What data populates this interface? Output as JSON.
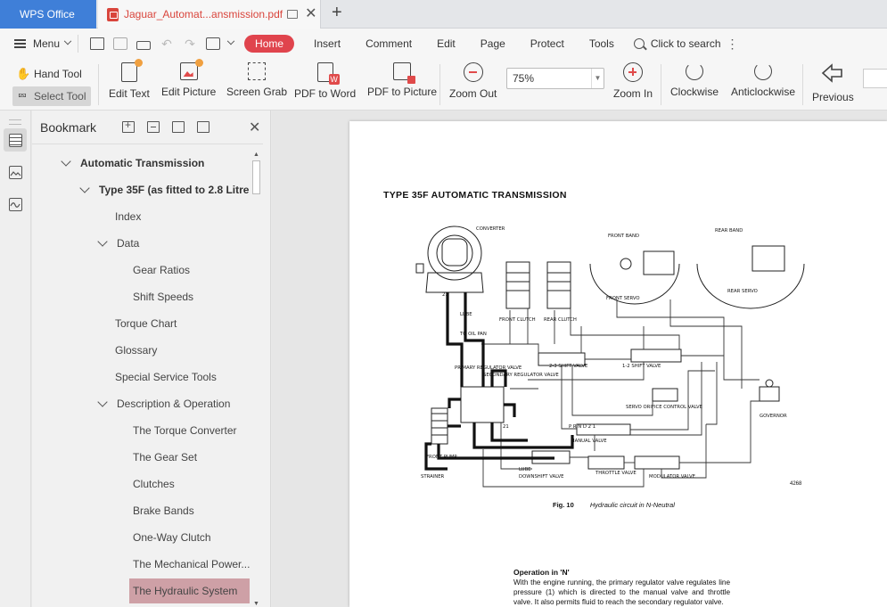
{
  "titlebar": {
    "app_name": "WPS Office",
    "doc_tab_title": "Jaguar_Automat...ansmission.pdf"
  },
  "menubar": {
    "menu_label": "Menu",
    "tabs": [
      "Home",
      "Insert",
      "Comment",
      "Edit",
      "Page",
      "Protect",
      "Tools"
    ],
    "search_label": "Click to search"
  },
  "ribbon": {
    "hand_tool": "Hand Tool",
    "select_tool": "Select Tool",
    "edit_text": "Edit Text",
    "edit_picture": "Edit Picture",
    "screen_grab": "Screen Grab",
    "pdf_to_word": "PDF to Word",
    "pdf_to_picture": "PDF to Picture",
    "zoom_out": "Zoom Out",
    "zoom_value": "75%",
    "zoom_in": "Zoom In",
    "clockwise": "Clockwise",
    "anticlockwise": "Anticlockwise",
    "previous": "Previous"
  },
  "bookmark_panel": {
    "title": "Bookmark",
    "items": [
      {
        "label": "Automatic Transmission",
        "level": 1,
        "expanded": true
      },
      {
        "label": "Type 35F (as fitted to 2.8 Litre",
        "level": 2,
        "expanded": true
      },
      {
        "label": "Index",
        "level": 3
      },
      {
        "label": "Data",
        "level": 3,
        "expanded": true
      },
      {
        "label": "Gear Ratios",
        "level": 4
      },
      {
        "label": "Shift Speeds",
        "level": 4
      },
      {
        "label": "Torque Chart",
        "level": 3
      },
      {
        "label": "Glossary",
        "level": 3
      },
      {
        "label": "Special Service Tools",
        "level": 3
      },
      {
        "label": "Description & Operation",
        "level": 3,
        "expanded": true
      },
      {
        "label": "The Torque Converter",
        "level": 4
      },
      {
        "label": "The Gear Set",
        "level": 4
      },
      {
        "label": "Clutches",
        "level": 4
      },
      {
        "label": "Brake Bands",
        "level": 4
      },
      {
        "label": "One-Way Clutch",
        "level": 4
      },
      {
        "label": "The Mechanical Power...",
        "level": 4
      },
      {
        "label": "The Hydraulic System",
        "level": 4,
        "selected": true
      }
    ]
  },
  "document": {
    "heading": "TYPE 35F AUTOMATIC TRANSMISSION",
    "diagram_labels": {
      "converter": "CONVERTER",
      "front_band": "FRONT BAND",
      "rear_band": "REAR BAND",
      "rear_servo": "REAR SERVO",
      "front_servo": "FRONT SERVO",
      "front_clutch": "FRONT CLUTCH",
      "rear_clutch": "REAR CLUTCH",
      "lube": "LUBE",
      "to_oil_pan": "TO OIL PAN",
      "primary_regulator": "PRIMARY REGULATOR VALVE",
      "secondary_regulator": "SECONDARY REGULATOR VALVE",
      "shift_valve_23": "2-3 SHIFT VALVE",
      "shift_valve_12": "1-2 SHIFT VALVE",
      "servo_orifice": "SERVO ORIFICE CONTROL VALVE",
      "governor": "GOVERNOR",
      "manual_valve": "MANUAL VALVE",
      "prnd21": "P R N D 2 1",
      "front_pump": "FRONT PUMP",
      "strainer": "STRAINER",
      "downshift_valve": "DOWNSHIFT VALVE",
      "throttle_valve": "THROTTLE VALVE",
      "modulator_valve": "MODULATOR VALVE",
      "lube_bottom": "LUBE",
      "num_21": "21",
      "num_21b": "21"
    },
    "figure_number": "4268",
    "caption_fig": "Fig. 10",
    "caption_text": "Hydraulic circuit in N-Neutral",
    "op_title": "Operation in 'N'",
    "op_body": "With the engine running, the primary regulator valve regulates line pressure (1) which is directed to the manual valve and throttle valve. It also permits fluid to reach the secondary regulator valve."
  },
  "colors": {
    "accent_blue": "#3f7fd8",
    "home_red": "#e0444d",
    "selected_bookmark": "#cea0a6"
  }
}
